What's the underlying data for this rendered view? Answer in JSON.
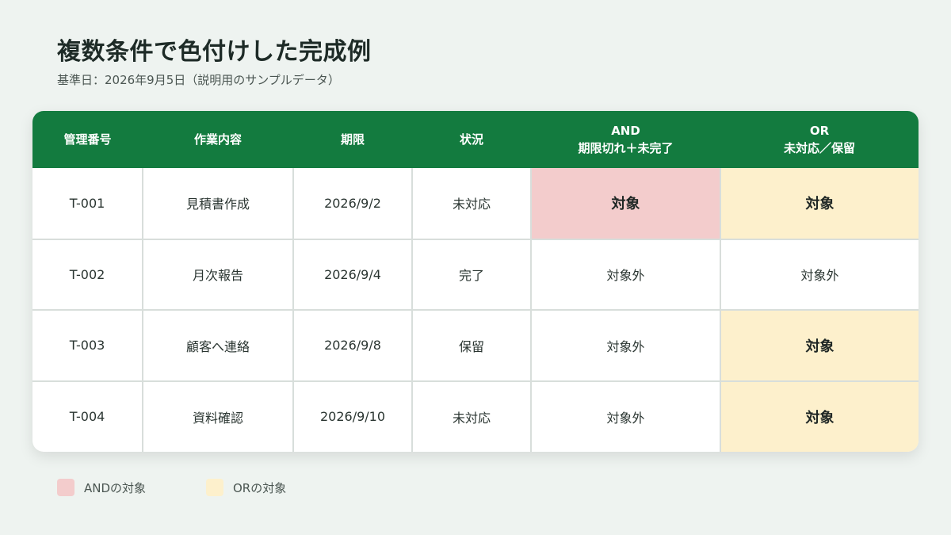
{
  "title": "複数条件で色付けした完成例",
  "subtitle": "基準日：2026年9月5日（説明用のサンプルデータ）",
  "table": {
    "headers": [
      "管理番号",
      "作業内容",
      "期限",
      "状況",
      "AND\n期限切れ＋未完了",
      "OR\n未対応／保留"
    ],
    "rows": [
      {
        "id": "T-001",
        "task": "見積書作成",
        "due": "2026/9/2",
        "status": "未対応",
        "and": "対象",
        "or": "対象"
      },
      {
        "id": "T-002",
        "task": "月次報告",
        "due": "2026/9/4",
        "status": "完了",
        "and": "対象外",
        "or": "対象外"
      },
      {
        "id": "T-003",
        "task": "顧客へ連絡",
        "due": "2026/9/8",
        "status": "保留",
        "and": "対象外",
        "or": "対象"
      },
      {
        "id": "T-004",
        "task": "資料確認",
        "due": "2026/9/10",
        "status": "未対応",
        "and": "対象外",
        "or": "対象"
      }
    ]
  },
  "colors": {
    "header": "#137b3f",
    "and_highlight": "#f3cccc",
    "or_highlight": "#fdf0cc"
  },
  "legend": [
    {
      "label": "ANDの対象",
      "color": "#f3cccc"
    },
    {
      "label": "ORの対象",
      "color": "#fdf0cc"
    }
  ]
}
